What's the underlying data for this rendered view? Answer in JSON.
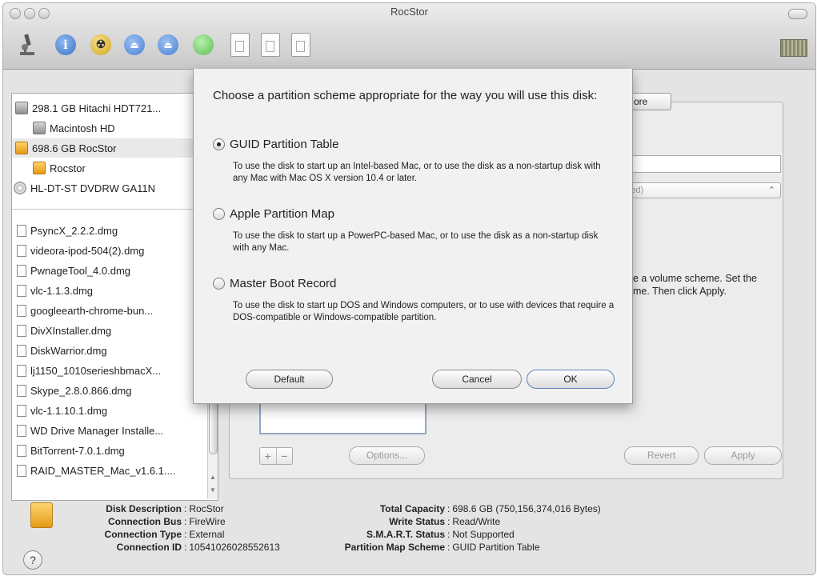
{
  "window": {
    "title": "RocStor"
  },
  "toolbar": {
    "icons": [
      "microscope-icon",
      "info-icon",
      "burn-icon",
      "mount-icon",
      "eject-icon",
      "enable-journaling-icon",
      "new-image-icon",
      "convert-icon",
      "resize-image-icon"
    ],
    "colors": {
      "info": "#4a86d8",
      "burn": "#e7c234",
      "mount": "#5b94e0",
      "eject": "#5b94e0",
      "journal": "#6fce66"
    }
  },
  "sidebar": {
    "devices": [
      {
        "label": "298.1 GB Hitachi HDT721...",
        "icon": "hdd-icon",
        "indent": 0
      },
      {
        "label": "Macintosh HD",
        "icon": "volume-icon",
        "indent": 1
      },
      {
        "label": "698.6 GB RocStor",
        "icon": "external-drive-icon",
        "indent": 0,
        "selected": true
      },
      {
        "label": "Rocstor",
        "icon": "external-volume-icon",
        "indent": 1
      },
      {
        "label": "HL-DT-ST DVDRW GA11N",
        "icon": "optical-drive-icon",
        "indent": 0
      }
    ],
    "images": [
      "PsyncX_2.2.2.dmg",
      "videora-ipod-504(2).dmg",
      "PwnageTool_4.0.dmg",
      "vlc-1.1.3.dmg",
      "googleearth-chrome-bun...",
      "DivXInstaller.dmg",
      "DiskWarrior.dmg",
      "lj1150_1010serieshbmacX...",
      "Skype_2.8.0.866.dmg",
      "vlc-1.1.10.1.dmg",
      "WD Drive Manager Installe...",
      "BitTorrent-7.0.1.dmg",
      "RAID_MASTER_Mac_v1.6.1...."
    ]
  },
  "main": {
    "tab_label": "ore",
    "select_value": "led)",
    "select_suffix": "⌃",
    "instructions_line1": "e a volume scheme. Set the",
    "instructions_line2": "me. Then click Apply.",
    "plus": "+",
    "minus": "−",
    "options_button": "Options...",
    "revert_button": "Revert",
    "apply_button": "Apply"
  },
  "sheet": {
    "title": "Choose a partition scheme appropriate for the way you will use this disk:",
    "options": [
      {
        "label": "GUID Partition Table",
        "selected": true,
        "description": "To use the disk to start up an Intel-based Mac, or to use the disk as a non-startup disk with any Mac with Mac OS X version 10.4 or later."
      },
      {
        "label": "Apple Partition Map",
        "selected": false,
        "description": "To use the disk to start up a PowerPC-based Mac, or to use the disk as a non-startup disk with any Mac."
      },
      {
        "label": "Master Boot Record",
        "selected": false,
        "description": "To use the disk to start up DOS and Windows computers, or to use with devices that require a DOS-compatible or Windows-compatible partition."
      }
    ],
    "default_button": "Default",
    "cancel_button": "Cancel",
    "ok_button": "OK"
  },
  "info": {
    "left": [
      {
        "k": "Disk Description",
        "v": "RocStor"
      },
      {
        "k": "Connection Bus",
        "v": "FireWire"
      },
      {
        "k": "Connection Type",
        "v": "External"
      },
      {
        "k": "Connection ID",
        "v": "10541026028552613"
      }
    ],
    "right": [
      {
        "k": "Total Capacity",
        "v": "698.6 GB (750,156,374,016 Bytes)"
      },
      {
        "k": "Write Status",
        "v": "Read/Write"
      },
      {
        "k": "S.M.A.R.T. Status",
        "v": "Not Supported"
      },
      {
        "k": "Partition Map Scheme",
        "v": "GUID Partition Table"
      }
    ],
    "separator": ":"
  },
  "help": {
    "label": "?"
  }
}
